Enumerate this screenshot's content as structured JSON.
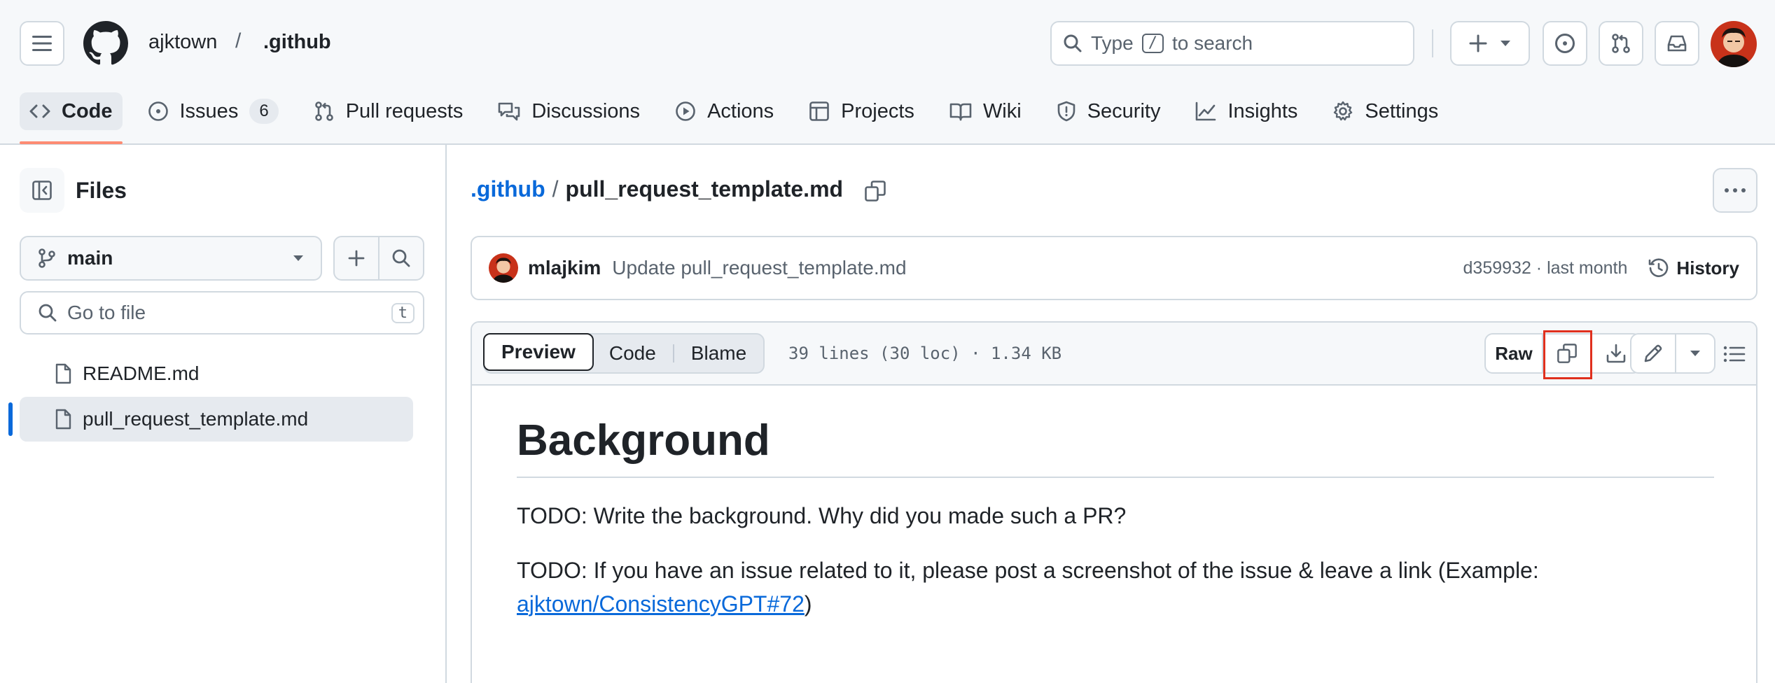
{
  "header": {
    "owner": "ajktown",
    "separator": "/",
    "repo": ".github",
    "search_prefix": "Type",
    "search_key": "/",
    "search_suffix": "to search"
  },
  "repo_nav": {
    "tabs": [
      {
        "label": "Code",
        "active": true,
        "icon": "code-icon"
      },
      {
        "label": "Issues",
        "counter": "6",
        "icon": "issue-opened-icon"
      },
      {
        "label": "Pull requests",
        "icon": "git-pull-request-icon"
      },
      {
        "label": "Discussions",
        "icon": "comment-discussion-icon"
      },
      {
        "label": "Actions",
        "icon": "play-icon"
      },
      {
        "label": "Projects",
        "icon": "table-icon"
      },
      {
        "label": "Wiki",
        "icon": "book-icon"
      },
      {
        "label": "Security",
        "icon": "shield-icon"
      },
      {
        "label": "Insights",
        "icon": "graph-icon"
      },
      {
        "label": "Settings",
        "icon": "gear-icon"
      }
    ]
  },
  "sidebar": {
    "title": "Files",
    "branch": "main",
    "goto_placeholder": "Go to file",
    "goto_key": "t",
    "files": [
      {
        "name": "README.md"
      },
      {
        "name": "pull_request_template.md",
        "selected": true
      }
    ]
  },
  "main": {
    "path_repo": ".github",
    "path_sep": "/",
    "path_file": "pull_request_template.md",
    "commit": {
      "author": "mlajkim",
      "message": "Update pull_request_template.md",
      "meta": "d359932 · last month",
      "history_label": "History"
    },
    "view_tabs": [
      "Preview",
      "Code",
      "Blame"
    ],
    "file_info": "39 lines (30 loc) · 1.34 KB",
    "raw_label": "Raw",
    "markdown": {
      "heading": "Background",
      "p1": "TODO: Write the background. Why did you made such a PR?",
      "p2_text": "TODO: If you have an issue related to it, please post a screenshot of the issue & leave a link (Example:",
      "p2_link": "ajktown/ConsistencyGPT#72",
      "p2_tail": ")"
    }
  },
  "colors": {
    "accent_blue": "#0969da",
    "active_underline": "#fd8c73",
    "highlight_box": "#e0301e",
    "border": "#d1d9e0"
  }
}
